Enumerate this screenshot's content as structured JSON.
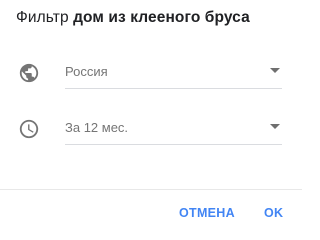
{
  "dialog": {
    "title_prefix": "Фильтр",
    "title_term": "дом из клееного бруса"
  },
  "fields": {
    "region": {
      "icon": "globe-icon",
      "value": "Россия"
    },
    "period": {
      "icon": "clock-icon",
      "value": "За 12 мес."
    }
  },
  "actions": {
    "cancel_label": "ОТМЕНА",
    "ok_label": "OK"
  },
  "colors": {
    "accent": "#4285f4",
    "icon": "#757575",
    "text_primary": "#202124",
    "text_secondary": "#757575",
    "underline": "#dadce0"
  }
}
